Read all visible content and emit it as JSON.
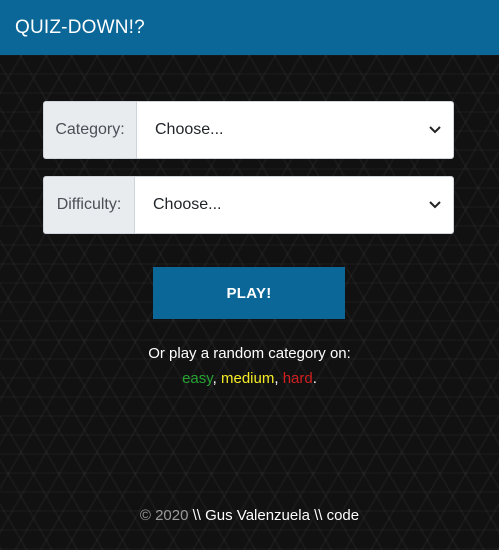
{
  "header": {
    "title": "QUIZ-DOWN!?"
  },
  "form": {
    "category": {
      "label": "Category:",
      "value": "Choose..."
    },
    "difficulty": {
      "label": "Difficulty:",
      "value": "Choose..."
    },
    "play_label": "PLAY!"
  },
  "random": {
    "text": "Or play a random category on:",
    "easy": "easy",
    "medium": "medium",
    "hard": "hard"
  },
  "footer": {
    "copyright": "© 2020",
    "author": "\\\\ Gus Valenzuela \\\\ code"
  },
  "colors": {
    "accent": "#0b6797",
    "easy": "#27a334",
    "medium": "#f5ec26",
    "hard": "#d21f1f"
  }
}
